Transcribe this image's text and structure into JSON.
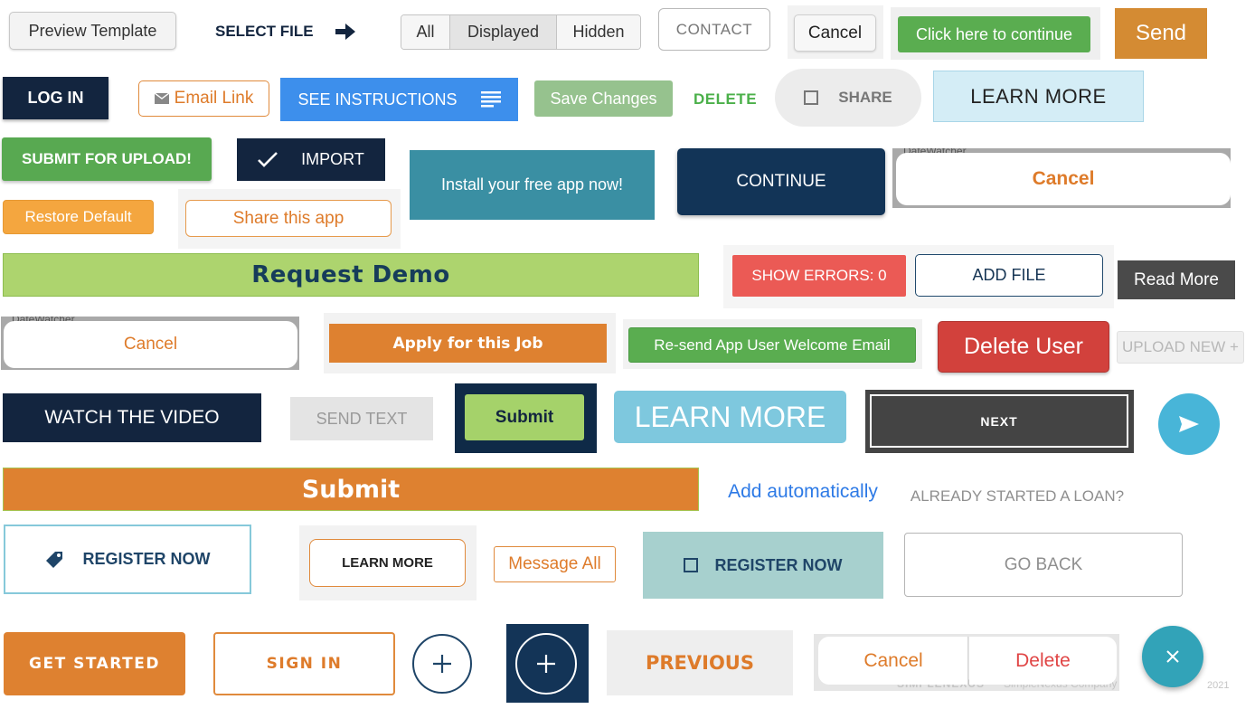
{
  "row1": {
    "preview_template": "Preview Template",
    "select_file": "SELECT FILE",
    "seg_all": "All",
    "seg_displayed": "Displayed",
    "seg_hidden": "Hidden",
    "contact": "CONTACT",
    "cancel": "Cancel",
    "click_continue": "Click here to continue",
    "send": "Send"
  },
  "row2": {
    "log_in": "LOG IN",
    "email_link": "Email Link",
    "see_instructions": "SEE INSTRUCTIONS",
    "save_changes": "Save Changes",
    "delete": "DELETE",
    "share": "SHARE",
    "learn_more": "LEARN MORE"
  },
  "row3": {
    "submit_upload": "SUBMIT FOR UPLOAD!",
    "import": "IMPORT",
    "install_app": "Install your free app now!",
    "continue": "CONTINUE",
    "cancel_ios": "Cancel",
    "bg_app_title": "DateWatcher",
    "restore_default": "Restore Default",
    "share_app": "Share this app"
  },
  "row4": {
    "request_demo": "Request Demo",
    "show_errors": "SHOW ERRORS: 0",
    "add_file": "ADD FILE",
    "read_more": "Read More"
  },
  "row5": {
    "cancel_ios": "Cancel",
    "bg_app_title": "DateWatcher",
    "apply_job": "Apply for this Job",
    "resend_email": "Re-send App User Welcome Email",
    "delete_user": "Delete User",
    "upload_new": "UPLOAD NEW +"
  },
  "row6": {
    "watch_video": "WATCH THE VIDEO",
    "send_text": "SEND TEXT",
    "submit": "Submit",
    "learn_more": "LEARN MORE",
    "next": "NEXT"
  },
  "row7": {
    "submit": "Submit",
    "add_automatically": "Add automatically",
    "already_started": "ALREADY STARTED A LOAN?"
  },
  "row8": {
    "register_now": "REGISTER NOW",
    "learn_more": "LEARN MORE",
    "message_all": "Message All",
    "register_now_2": "REGISTER NOW",
    "go_back": "GO BACK"
  },
  "row9": {
    "get_started": "GET STARTED",
    "sign_in": "SIGN IN",
    "previous": "PREVIOUS",
    "cancel": "Cancel",
    "delete": "Delete",
    "footer_brand": "SIMPLENEXUS",
    "footer_company": "SimpleNexus Company",
    "footer_year": "2021"
  },
  "icons": {
    "arrow": "arrow-right-icon",
    "envelope": "envelope-icon",
    "list": "list-icon",
    "checkbox": "checkbox-icon",
    "check": "check-icon",
    "send": "send-icon",
    "tag": "tag-icon",
    "plus": "plus-icon",
    "close": "close-icon"
  },
  "colors": {
    "navy": "#0f2a47",
    "orange": "#de8130",
    "green": "#5aad50",
    "teal": "#3a8fa3",
    "red": "#e05a56",
    "lime": "#a8d36a",
    "sky": "#7ec8de"
  }
}
